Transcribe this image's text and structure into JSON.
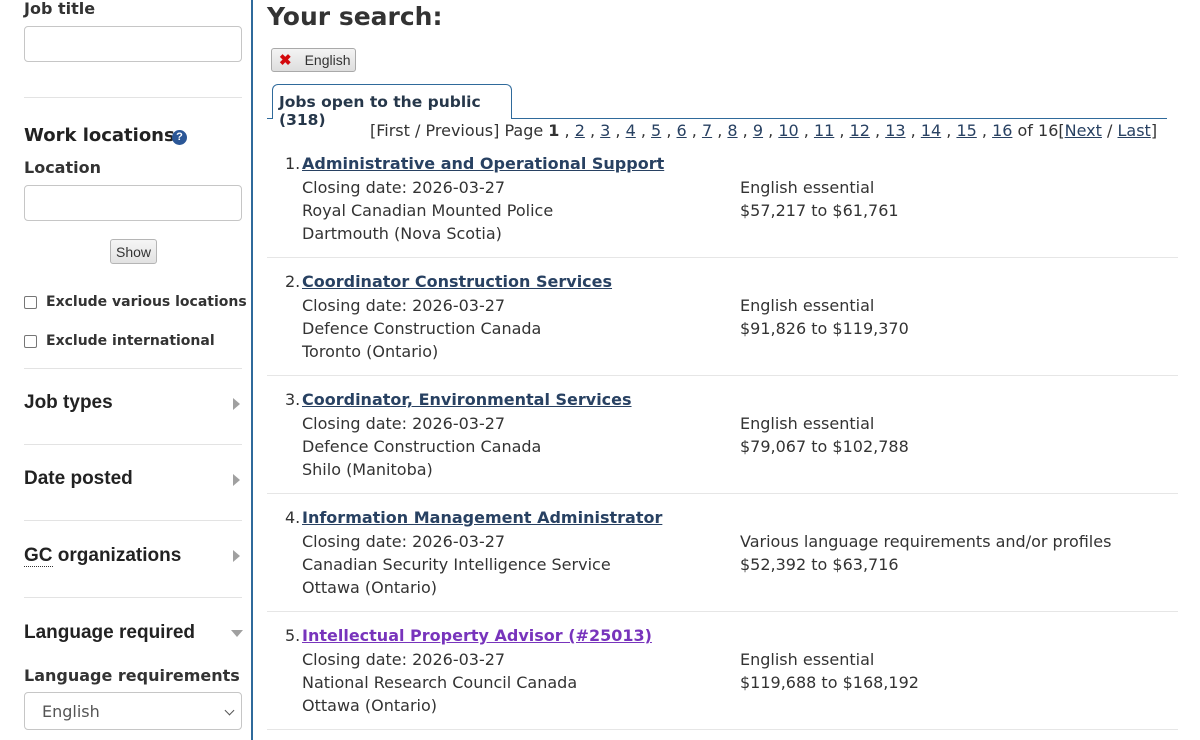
{
  "sidebar": {
    "job_title_label": "Job title",
    "job_title_value": "",
    "work_locations_heading": "Work locations",
    "help_icon": "?",
    "location_label": "Location",
    "location_value": "",
    "show_button": "Show",
    "exclude_various": "Exclude various locations",
    "exclude_international": "Exclude international",
    "job_types": "Job types",
    "date_posted": "Date posted",
    "gc_abbr": "GC",
    "gc_rest": " organizations",
    "language_required": "Language required",
    "language_requirements_label": "Language requirements",
    "language_select_value": "English"
  },
  "main": {
    "title": "Your search:",
    "filter_chip": {
      "remove_icon": "✖",
      "label": "English"
    },
    "tab_label": "Jobs open to the public (318)",
    "pagination": {
      "first": "[First",
      "separator": "/",
      "previous": "Previous]",
      "page_word": "Page",
      "current": "1",
      "pages": [
        "2",
        "3",
        "4",
        "5",
        "6",
        "7",
        "8",
        "9",
        "10",
        "11",
        "12",
        "13",
        "14",
        "15",
        "16"
      ],
      "of_text": "of 16",
      "next": "Next",
      "last": "Last",
      "open_bracket": "[",
      "close_bracket": "]"
    },
    "results": [
      {
        "num": "1.",
        "title": "Administrative and Operational Support",
        "closing": "Closing date: 2026-03-27",
        "org": "Royal Canadian Mounted Police",
        "location": "Dartmouth (Nova Scotia)",
        "language": "English essential",
        "salary": "$57,217 to $61,761"
      },
      {
        "num": "2.",
        "title": "Coordinator Construction Services",
        "closing": "Closing date: 2026-03-27",
        "org": "Defence Construction Canada",
        "location": "Toronto (Ontario)",
        "language": "English essential",
        "salary": "$91,826 to $119,370"
      },
      {
        "num": "3.",
        "title": "Coordinator, Environmental Services",
        "closing": "Closing date: 2026-03-27",
        "org": "Defence Construction Canada",
        "location": "Shilo (Manitoba)",
        "language": "English essential",
        "salary": "$79,067 to $102,788"
      },
      {
        "num": "4.",
        "title": "Information Management Administrator",
        "closing": "Closing date: 2026-03-27",
        "org": "Canadian Security Intelligence Service",
        "location": "Ottawa (Ontario)",
        "language": "Various language requirements and/or profiles",
        "salary": "$52,392 to $63,716"
      },
      {
        "num": "5.",
        "title": "Intellectual Property Advisor (#25013)",
        "closing": "Closing date: 2026-03-27",
        "org": "National Research Council Canada",
        "location": "Ottawa (Ontario)",
        "language": "English essential",
        "salary": "$119,688 to $168,192"
      }
    ]
  }
}
